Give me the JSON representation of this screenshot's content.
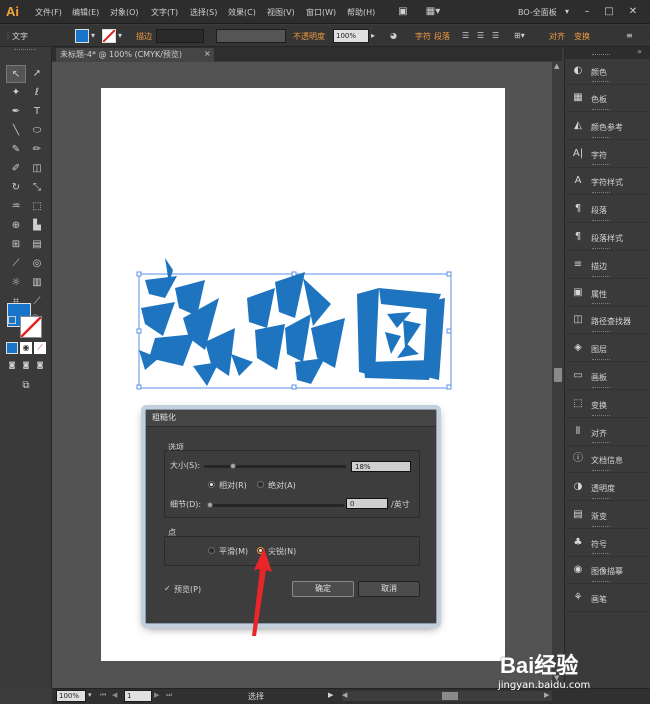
{
  "app": {
    "logo": "Ai",
    "workspace": "BO-全面板"
  },
  "menu": [
    "文件(F)",
    "编辑(E)",
    "对象(O)",
    "文字(T)",
    "选择(S)",
    "效果(C)",
    "视图(V)",
    "窗口(W)",
    "帮助(H)"
  ],
  "control": {
    "context_label": "文字",
    "stroke_label": "描边",
    "opacity_label": "不透明度",
    "opacity_value": "100%",
    "char_label": "字符",
    "para_label": "段落",
    "align_label": "对齐",
    "transform_label": "变换"
  },
  "document_tab": "未标题-4* @ 100% (CMYK/预览)",
  "panels": [
    "颜色",
    "色板",
    "颜色参考",
    "字符",
    "字符样式",
    "段落",
    "段落样式",
    "描边",
    "属性",
    "路径查找器",
    "图层",
    "画板",
    "变换",
    "对齐",
    "文档信息",
    "透明度",
    "渐变",
    "符号",
    "图像描摹",
    "画笔"
  ],
  "status": {
    "zoom": "100%",
    "page": "1",
    "tool": "选择"
  },
  "dialog": {
    "title": "粗糙化",
    "options_group": "选项",
    "size_label": "大小(S):",
    "size_value": "18%",
    "relative_label": "相对(R)",
    "absolute_label": "绝对(A)",
    "detail_label": "细节(D):",
    "detail_value": "0",
    "detail_unit": "/英寸",
    "points_group": "点",
    "smooth_label": "平滑(M)",
    "corner_label": "尖锐(N)",
    "preview_label": "预览(P)",
    "ok_label": "确定",
    "cancel_label": "取消"
  },
  "watermark": {
    "brand": "Bai经验",
    "url": "jingyan.baidu.com"
  },
  "colors": {
    "fill": "#1874c8",
    "accent": "#f09a3e",
    "artwork": "#1f74c0"
  }
}
